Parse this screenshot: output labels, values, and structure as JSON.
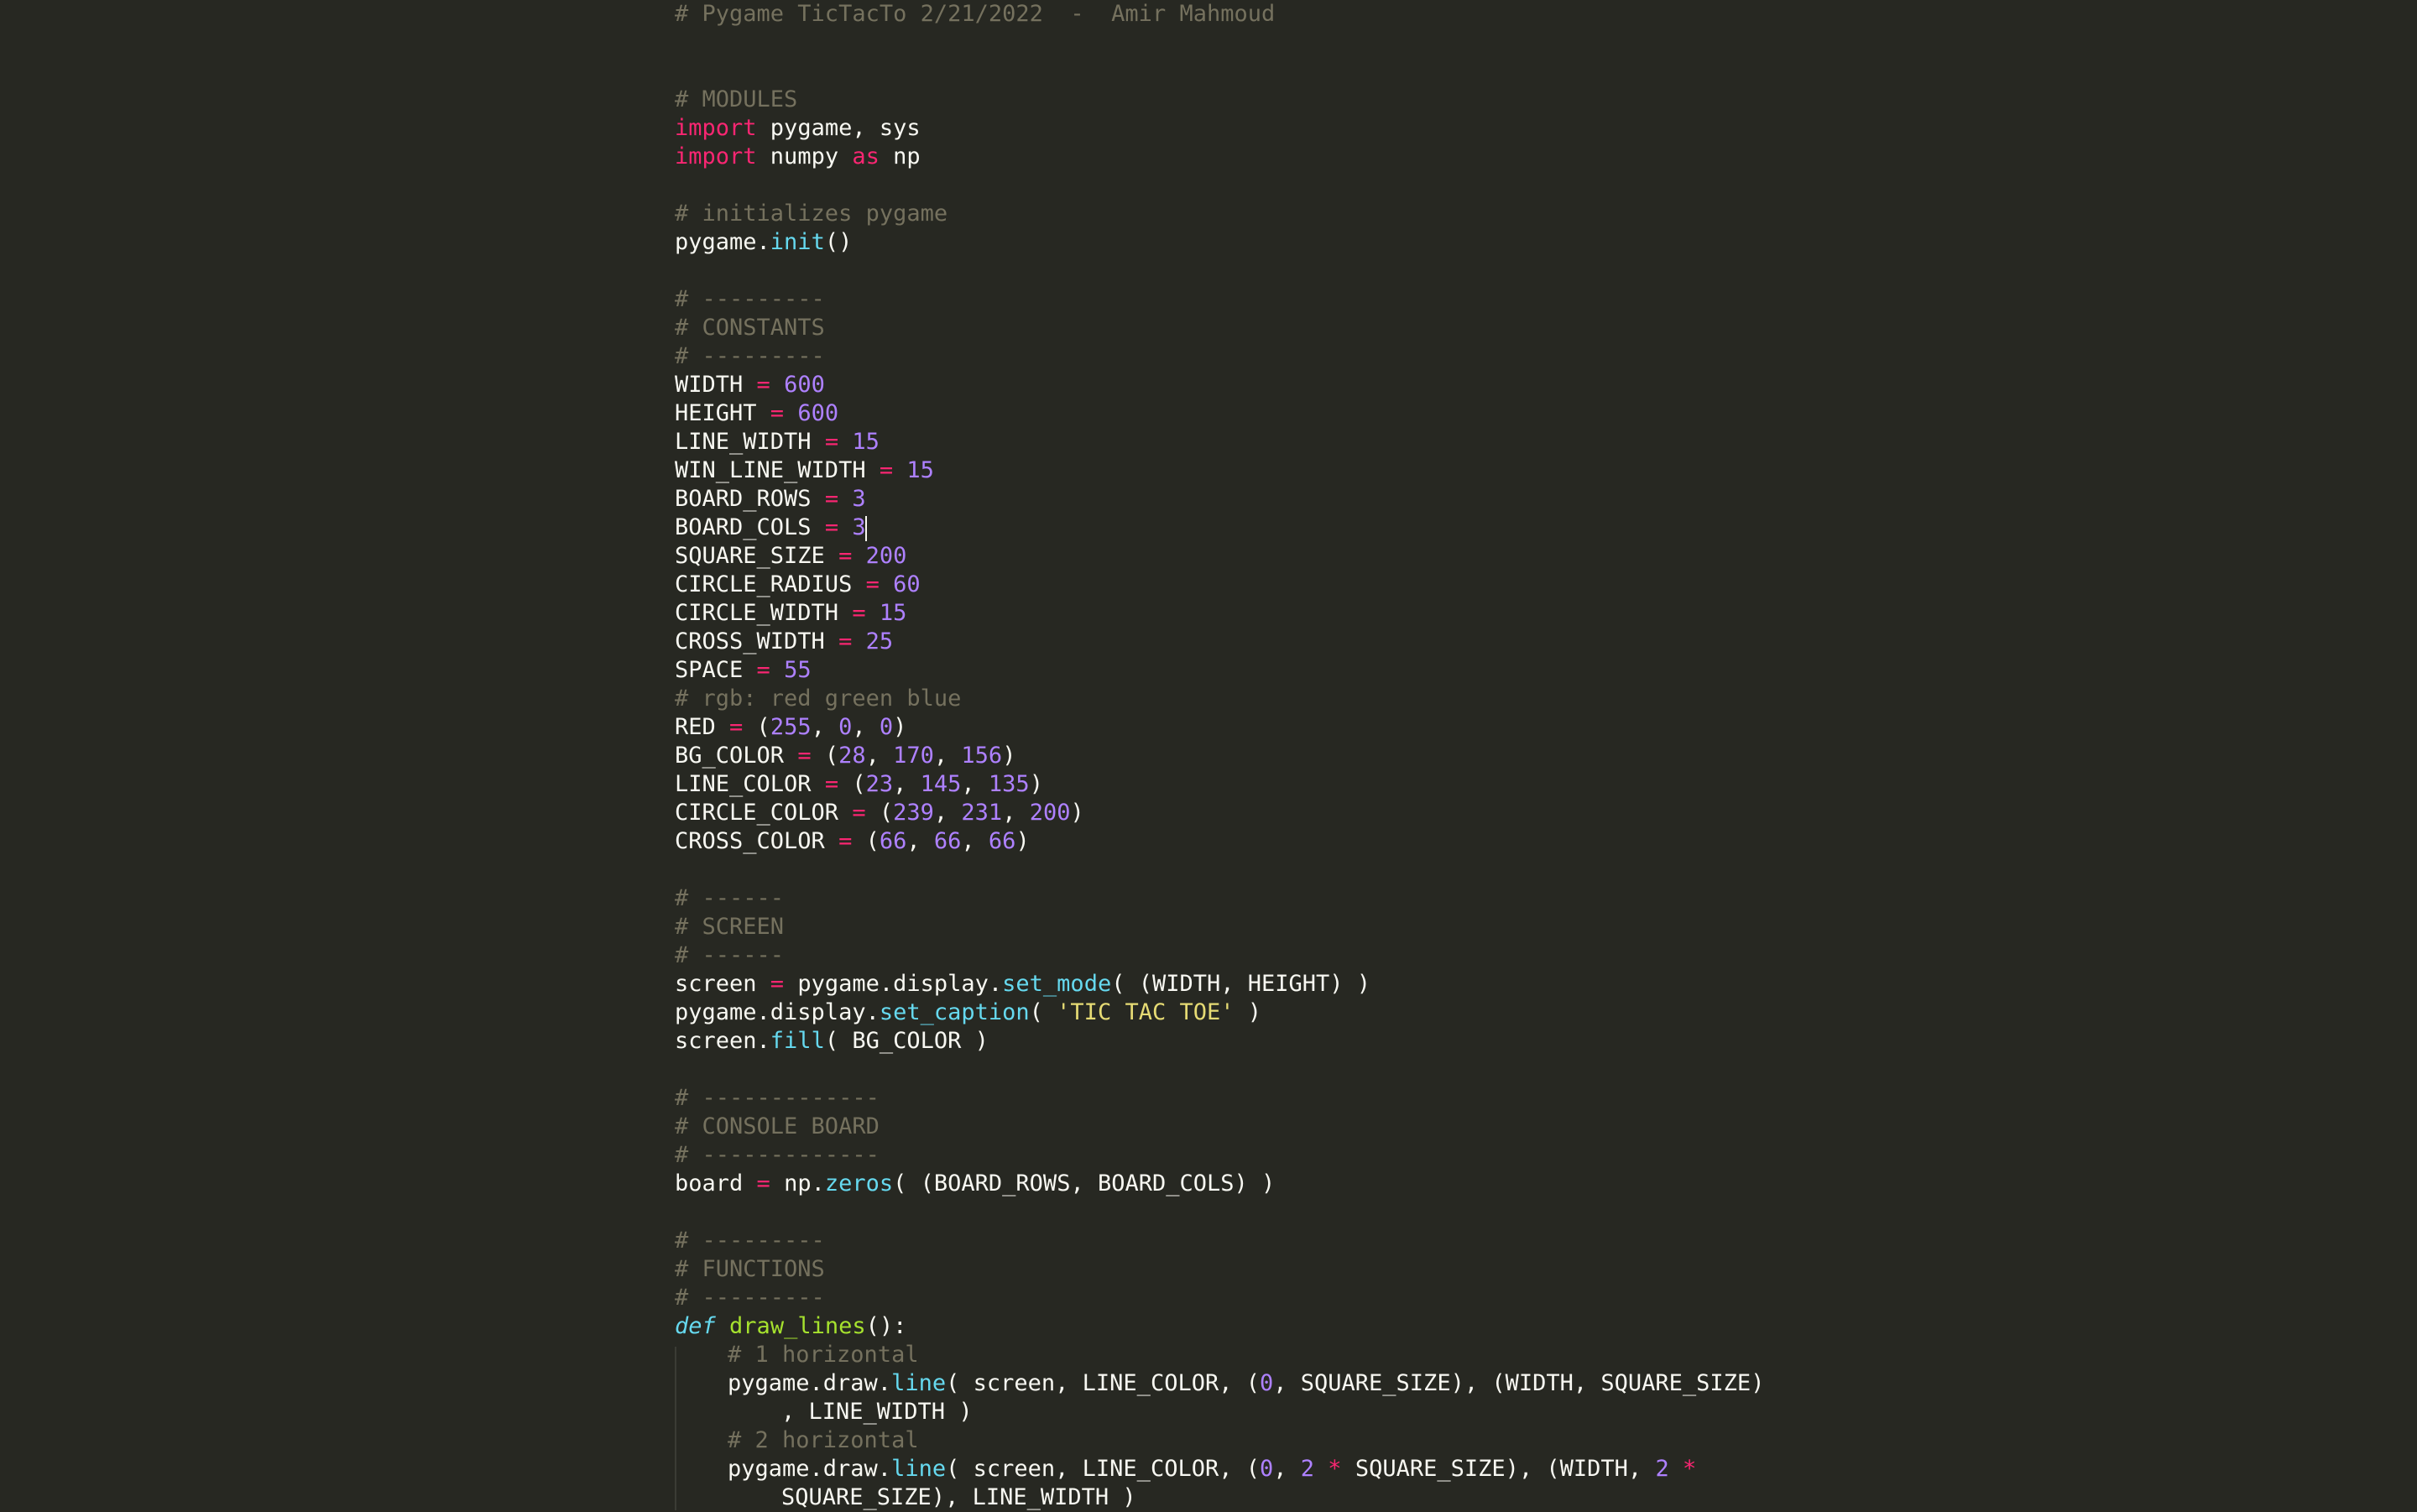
{
  "editor": {
    "theme": "monokai",
    "colors": {
      "background": "#272822",
      "text": "#f8f8f2",
      "comment": "#75715e",
      "keyword": "#f92672",
      "number": "#ae81ff",
      "function_call": "#66d9ef",
      "string": "#e6db74",
      "definition": "#a6e22e"
    },
    "lines": [
      [
        {
          "c": "c",
          "t": "# Pygame TicTacTo 2/21/2022  -  Amir Mahmoud"
        }
      ],
      [],
      [],
      [
        {
          "c": "c",
          "t": "# MODULES"
        }
      ],
      [
        {
          "c": "k",
          "t": "import"
        },
        {
          "c": "",
          "t": " pygame, sys"
        }
      ],
      [
        {
          "c": "k",
          "t": "import"
        },
        {
          "c": "",
          "t": " numpy "
        },
        {
          "c": "k",
          "t": "as"
        },
        {
          "c": "",
          "t": " np"
        }
      ],
      [],
      [
        {
          "c": "c",
          "t": "# initializes pygame"
        }
      ],
      [
        {
          "c": "",
          "t": "pygame."
        },
        {
          "c": "f",
          "t": "init"
        },
        {
          "c": "",
          "t": "()"
        }
      ],
      [],
      [
        {
          "c": "c",
          "t": "# ---------"
        }
      ],
      [
        {
          "c": "c",
          "t": "# CONSTANTS"
        }
      ],
      [
        {
          "c": "c",
          "t": "# ---------"
        }
      ],
      [
        {
          "c": "",
          "t": "WIDTH "
        },
        {
          "c": "o",
          "t": "="
        },
        {
          "c": "",
          "t": " "
        },
        {
          "c": "n",
          "t": "600"
        }
      ],
      [
        {
          "c": "",
          "t": "HEIGHT "
        },
        {
          "c": "o",
          "t": "="
        },
        {
          "c": "",
          "t": " "
        },
        {
          "c": "n",
          "t": "600"
        }
      ],
      [
        {
          "c": "",
          "t": "LINE_WIDTH "
        },
        {
          "c": "o",
          "t": "="
        },
        {
          "c": "",
          "t": " "
        },
        {
          "c": "n",
          "t": "15"
        }
      ],
      [
        {
          "c": "",
          "t": "WIN_LINE_WIDTH "
        },
        {
          "c": "o",
          "t": "="
        },
        {
          "c": "",
          "t": " "
        },
        {
          "c": "n",
          "t": "15"
        }
      ],
      [
        {
          "c": "",
          "t": "BOARD_ROWS "
        },
        {
          "c": "o",
          "t": "="
        },
        {
          "c": "",
          "t": " "
        },
        {
          "c": "n",
          "t": "3"
        }
      ],
      [
        {
          "c": "",
          "t": "BOARD_COLS "
        },
        {
          "c": "o",
          "t": "="
        },
        {
          "c": "",
          "t": " "
        },
        {
          "c": "n",
          "t": "3"
        },
        {
          "c": "caret",
          "t": ""
        }
      ],
      [
        {
          "c": "",
          "t": "SQUARE_SIZE "
        },
        {
          "c": "o",
          "t": "="
        },
        {
          "c": "",
          "t": " "
        },
        {
          "c": "n",
          "t": "200"
        }
      ],
      [
        {
          "c": "",
          "t": "CIRCLE_RADIUS "
        },
        {
          "c": "o",
          "t": "="
        },
        {
          "c": "",
          "t": " "
        },
        {
          "c": "n",
          "t": "60"
        }
      ],
      [
        {
          "c": "",
          "t": "CIRCLE_WIDTH "
        },
        {
          "c": "o",
          "t": "="
        },
        {
          "c": "",
          "t": " "
        },
        {
          "c": "n",
          "t": "15"
        }
      ],
      [
        {
          "c": "",
          "t": "CROSS_WIDTH "
        },
        {
          "c": "o",
          "t": "="
        },
        {
          "c": "",
          "t": " "
        },
        {
          "c": "n",
          "t": "25"
        }
      ],
      [
        {
          "c": "",
          "t": "SPACE "
        },
        {
          "c": "o",
          "t": "="
        },
        {
          "c": "",
          "t": " "
        },
        {
          "c": "n",
          "t": "55"
        }
      ],
      [
        {
          "c": "c",
          "t": "# rgb: red green blue"
        }
      ],
      [
        {
          "c": "",
          "t": "RED "
        },
        {
          "c": "o",
          "t": "="
        },
        {
          "c": "",
          "t": " ("
        },
        {
          "c": "n",
          "t": "255"
        },
        {
          "c": "",
          "t": ", "
        },
        {
          "c": "n",
          "t": "0"
        },
        {
          "c": "",
          "t": ", "
        },
        {
          "c": "n",
          "t": "0"
        },
        {
          "c": "",
          "t": ")"
        }
      ],
      [
        {
          "c": "",
          "t": "BG_COLOR "
        },
        {
          "c": "o",
          "t": "="
        },
        {
          "c": "",
          "t": " ("
        },
        {
          "c": "n",
          "t": "28"
        },
        {
          "c": "",
          "t": ", "
        },
        {
          "c": "n",
          "t": "170"
        },
        {
          "c": "",
          "t": ", "
        },
        {
          "c": "n",
          "t": "156"
        },
        {
          "c": "",
          "t": ")"
        }
      ],
      [
        {
          "c": "",
          "t": "LINE_COLOR "
        },
        {
          "c": "o",
          "t": "="
        },
        {
          "c": "",
          "t": " ("
        },
        {
          "c": "n",
          "t": "23"
        },
        {
          "c": "",
          "t": ", "
        },
        {
          "c": "n",
          "t": "145"
        },
        {
          "c": "",
          "t": ", "
        },
        {
          "c": "n",
          "t": "135"
        },
        {
          "c": "",
          "t": ")"
        }
      ],
      [
        {
          "c": "",
          "t": "CIRCLE_COLOR "
        },
        {
          "c": "o",
          "t": "="
        },
        {
          "c": "",
          "t": " ("
        },
        {
          "c": "n",
          "t": "239"
        },
        {
          "c": "",
          "t": ", "
        },
        {
          "c": "n",
          "t": "231"
        },
        {
          "c": "",
          "t": ", "
        },
        {
          "c": "n",
          "t": "200"
        },
        {
          "c": "",
          "t": ")"
        }
      ],
      [
        {
          "c": "",
          "t": "CROSS_COLOR "
        },
        {
          "c": "o",
          "t": "="
        },
        {
          "c": "",
          "t": " ("
        },
        {
          "c": "n",
          "t": "66"
        },
        {
          "c": "",
          "t": ", "
        },
        {
          "c": "n",
          "t": "66"
        },
        {
          "c": "",
          "t": ", "
        },
        {
          "c": "n",
          "t": "66"
        },
        {
          "c": "",
          "t": ")"
        }
      ],
      [],
      [
        {
          "c": "c",
          "t": "# ------"
        }
      ],
      [
        {
          "c": "c",
          "t": "# SCREEN"
        }
      ],
      [
        {
          "c": "c",
          "t": "# ------"
        }
      ],
      [
        {
          "c": "",
          "t": "screen "
        },
        {
          "c": "o",
          "t": "="
        },
        {
          "c": "",
          "t": " pygame.display."
        },
        {
          "c": "f",
          "t": "set_mode"
        },
        {
          "c": "",
          "t": "( (WIDTH, HEIGHT) )"
        }
      ],
      [
        {
          "c": "",
          "t": "pygame.display."
        },
        {
          "c": "f",
          "t": "set_caption"
        },
        {
          "c": "",
          "t": "( "
        },
        {
          "c": "s",
          "t": "'TIC TAC TOE'"
        },
        {
          "c": "",
          "t": " )"
        }
      ],
      [
        {
          "c": "",
          "t": "screen."
        },
        {
          "c": "f",
          "t": "fill"
        },
        {
          "c": "",
          "t": "( BG_COLOR )"
        }
      ],
      [],
      [
        {
          "c": "c",
          "t": "# -------------"
        }
      ],
      [
        {
          "c": "c",
          "t": "# CONSOLE BOARD"
        }
      ],
      [
        {
          "c": "c",
          "t": "# -------------"
        }
      ],
      [
        {
          "c": "",
          "t": "board "
        },
        {
          "c": "o",
          "t": "="
        },
        {
          "c": "",
          "t": " np."
        },
        {
          "c": "f",
          "t": "zeros"
        },
        {
          "c": "",
          "t": "( (BOARD_ROWS, BOARD_COLS) )"
        }
      ],
      [],
      [
        {
          "c": "c",
          "t": "# ---------"
        }
      ],
      [
        {
          "c": "c",
          "t": "# FUNCTIONS"
        }
      ],
      [
        {
          "c": "c",
          "t": "# ---------"
        }
      ],
      [
        {
          "c": "d",
          "t": "def"
        },
        {
          "c": "",
          "t": " "
        },
        {
          "c": "fn",
          "t": "draw_lines"
        },
        {
          "c": "",
          "t": "():"
        }
      ],
      {
        "indent": "indent",
        "tokens": [
          {
            "c": "c",
            "t": "# 1 horizontal"
          }
        ]
      },
      {
        "indent": "indent",
        "tokens": [
          {
            "c": "",
            "t": "pygame.draw."
          },
          {
            "c": "f",
            "t": "line"
          },
          {
            "c": "",
            "t": "( screen, LINE_COLOR, ("
          },
          {
            "c": "n",
            "t": "0"
          },
          {
            "c": "",
            "t": ", SQUARE_SIZE), (WIDTH, SQUARE_SIZE)"
          }
        ]
      },
      {
        "indent": "cont",
        "tokens": [
          {
            "c": "",
            "t": ", LINE_WIDTH )"
          }
        ]
      },
      {
        "indent": "indent",
        "tokens": [
          {
            "c": "c",
            "t": "# 2 horizontal"
          }
        ]
      },
      {
        "indent": "indent",
        "tokens": [
          {
            "c": "",
            "t": "pygame.draw."
          },
          {
            "c": "f",
            "t": "line"
          },
          {
            "c": "",
            "t": "( screen, LINE_COLOR, ("
          },
          {
            "c": "n",
            "t": "0"
          },
          {
            "c": "",
            "t": ", "
          },
          {
            "c": "n",
            "t": "2"
          },
          {
            "c": "",
            "t": " "
          },
          {
            "c": "o",
            "t": "*"
          },
          {
            "c": "",
            "t": " SQUARE_SIZE), (WIDTH, "
          },
          {
            "c": "n",
            "t": "2"
          },
          {
            "c": "",
            "t": " "
          },
          {
            "c": "o",
            "t": "*"
          }
        ]
      },
      {
        "indent": "cont",
        "tokens": [
          {
            "c": "",
            "t": "SQUARE_SIZE), LINE_WIDTH )"
          }
        ]
      }
    ]
  }
}
